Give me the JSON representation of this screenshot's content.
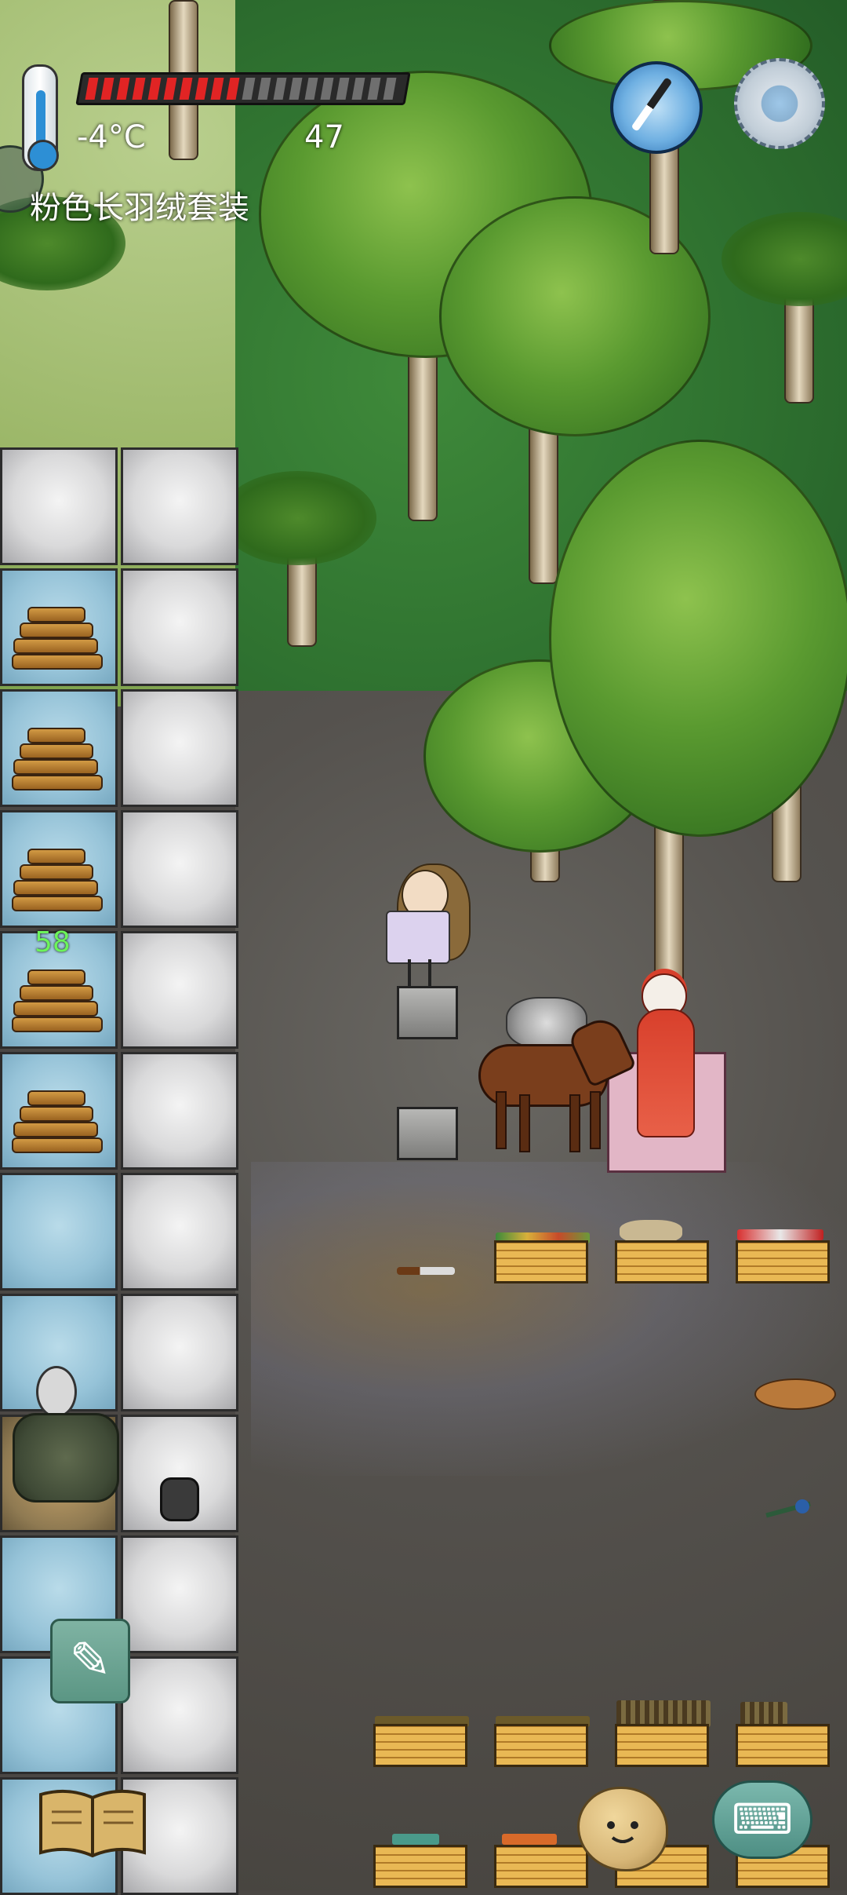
{
  "hud": {
    "temperature": "-4°C",
    "hunger_value": "47",
    "hunger_fraction": 0.5,
    "clothing_label": "粉色长羽绒套装",
    "thermometer_icon": "thermometer-icon",
    "compass_icon": "compass-icon",
    "settings_icon": "gear-icon"
  },
  "inventory": {
    "wood_count": "58"
  },
  "buttons": {
    "pencil_icon": "pencil-icon",
    "book_icon": "book-icon",
    "emote_icon": "potato-face-icon",
    "keyboard_icon": "keyboard-icon"
  },
  "colors": {
    "hunger_filled": "#e12424",
    "hunger_empty": "#6f6f6f",
    "count_text": "#6cf45a"
  }
}
